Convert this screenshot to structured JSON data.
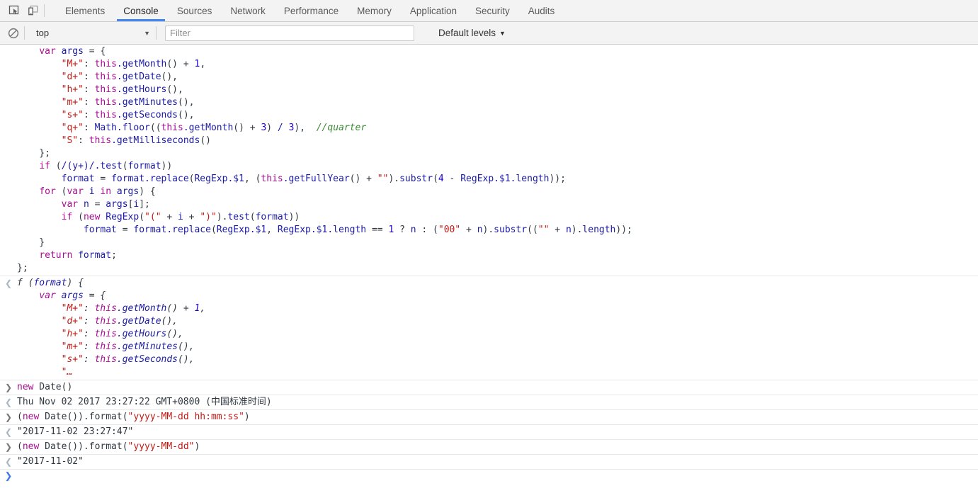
{
  "toolbar": {
    "inspect_icon": "inspect-element-icon",
    "device_icon": "device-toolbar-icon",
    "tabs": [
      {
        "label": "Elements",
        "active": false
      },
      {
        "label": "Console",
        "active": true
      },
      {
        "label": "Sources",
        "active": false
      },
      {
        "label": "Network",
        "active": false
      },
      {
        "label": "Performance",
        "active": false
      },
      {
        "label": "Memory",
        "active": false
      },
      {
        "label": "Application",
        "active": false
      },
      {
        "label": "Security",
        "active": false
      },
      {
        "label": "Audits",
        "active": false
      }
    ],
    "active_tab_color": "#4285f4"
  },
  "filterbar": {
    "clear_icon": "clear-console-icon",
    "context_value": "top",
    "context_caret": "▼",
    "filter_placeholder": "Filter",
    "filter_value": "",
    "levels_label": "Default levels",
    "levels_caret": "▼"
  },
  "console": {
    "input_marker": "❯",
    "output_marker": "❮",
    "prompt_marker": "❯",
    "entries": [
      {
        "type": "source",
        "marker": "",
        "lines": [
          "    var args = {",
          "        \"M+\": this.getMonth() + 1,",
          "        \"d+\": this.getDate(),",
          "        \"h+\": this.getHours(),",
          "        \"m+\": this.getMinutes(),",
          "        \"s+\": this.getSeconds(),",
          "        \"q+\": Math.floor((this.getMonth() + 3) / 3),  //quarter",
          "        \"S\": this.getMilliseconds()",
          "    };",
          "    if (/(y+)/.test(format))",
          "        format = format.replace(RegExp.$1, (this.getFullYear() + \"\").substr(4 - RegExp.$1.length));",
          "    for (var i in args) {",
          "        var n = args[i];",
          "        if (new RegExp(\"(\" + i + \")\").test(format))",
          "            format = format.replace(RegExp.$1, RegExp.$1.length == 1 ? n : (\"00\" + n).substr((\"\" + n).length));",
          "    }",
          "    return format;",
          "};"
        ]
      },
      {
        "type": "result-function",
        "marker": "❮",
        "lines": [
          "f (format) {",
          "    var args = {",
          "        \"M+\": this.getMonth() + 1,",
          "        \"d+\": this.getDate(),",
          "        \"h+\": this.getHours(),",
          "        \"m+\": this.getMinutes(),",
          "        \"s+\": this.getSeconds(),",
          "        \"…"
        ]
      },
      {
        "type": "input",
        "marker": "❯",
        "text": "new Date()"
      },
      {
        "type": "output",
        "marker": "❮",
        "text": "Thu Nov 02 2017 23:27:22 GMT+0800 (中国标准时间)"
      },
      {
        "type": "input",
        "marker": "❯",
        "text": "(new Date()).format(\"yyyy-MM-dd hh:mm:ss\")"
      },
      {
        "type": "output-string",
        "marker": "❮",
        "text": "\"2017-11-02 23:27:47\""
      },
      {
        "type": "input",
        "marker": "❯",
        "text": "(new Date()).format(\"yyyy-MM-dd\")"
      },
      {
        "type": "output-string",
        "marker": "❮",
        "text": "\"2017-11-02\""
      }
    ],
    "prompt_value": ""
  }
}
